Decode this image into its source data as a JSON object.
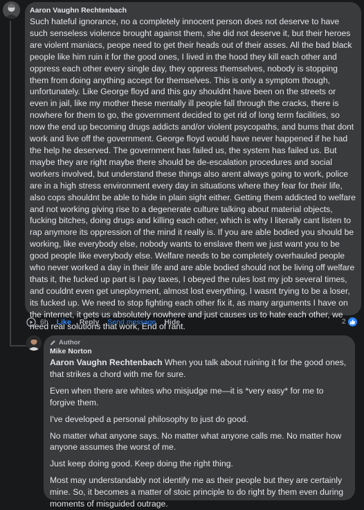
{
  "comment1": {
    "author": "Aaron Vaughn Rechtenbach",
    "text": "Such hateful ignorance, no a completely innocent person does not deserve to have such senseless violence brought against them, she did not deserve it, but their heroes are violent maniacs, peope need to get their heads out of their asses. All the bad black people like him ruin it for the good ones, I lived in the hood they kill each other and oppress each other every single day, they oppress themselves, nobody is stopping them from doing anything accept for themselves. This is only a symptom though, unfortunately. Like George floyd and this guy shouldnt have been on the streets or even in jail, like my mother these mentally ill people fall through the cracks, there is nowhere for them to go, the government decided to get rid of long term facilities, so now the end up becoming drugs addicts and/or violent psycopaths, and bums that dont work and live off the government. George floyd would have never happened if he had the help he deserved. The government has failed us, the system has failed us. But maybe they are right maybe there should be de-escalation procedures and social workers involved, but understand these things also arent always going to work, police are in a high stress environment every day in situations where they fear for their life, also cops shouldnt be able to hide in plain sight either. Getting them addicted to welfare and not working giving rise to a degenerate culture talking about material objects, fucking bitches, doing drugs and killing each other, which is why I literally cant listen to rap anymore its oppression of the mind it really is. If you are able bodied you should be working, like everybody else, nobody wants to enslave them we just want you to be good people like everybody else. Welfare needs to be completely overhauled people who never worked a day in their life and are able bodied should not be living off welfare thats it, the fucked up part is I pay taxes, I obeyed the rules lost my job several times, and couldnt even get uneployment, almost lost everything, I wasnt trying to be a loser, its fucked up. We need to stop fighting each other fix it, as many arguments I have on the internet, it gets us absolutely nowhere and just causes us to hate each other, we need real solutions that work, End of rant.",
    "time": "6h",
    "like_label": "Like",
    "reply_label": "Reply",
    "send_message_label": "Send message",
    "hide_label": "Hide",
    "reaction_count": "2"
  },
  "reply1": {
    "badge": "Author",
    "author": "Mike Norton",
    "mention": "Aaron Vaughn Rechtenbach",
    "paragraphs": [
      " When you talk about ruining it for the good ones, that strikes a chord with me for sure.",
      "Even when there are whites who misjudge me—it is *very easy* for me to forgive them.",
      "I've developed a personal philosophy to just do good.",
      "No matter what anyone says. No matter what anyone calls me. No matter how anyone assumes the worst of me.",
      "Just keep doing good. Keep doing the right thing.",
      "Most may understandably not identify me as their people but they are certainly mine. So, it becomes a matter of stoic principle to do right by them even during moments of misguided outrage."
    ]
  },
  "colors": {
    "background": "#18191a",
    "bubble": "#3a3b3c",
    "text": "#e4e6eb",
    "muted": "#b0b3b8",
    "link": "#2d88ff"
  },
  "icons": {
    "avatar1": "avatar-icon",
    "avatar2": "avatar-icon",
    "like_reaction": "thumbs-up-icon",
    "play": "play-circle-icon",
    "author_badge": "pencil-icon"
  }
}
